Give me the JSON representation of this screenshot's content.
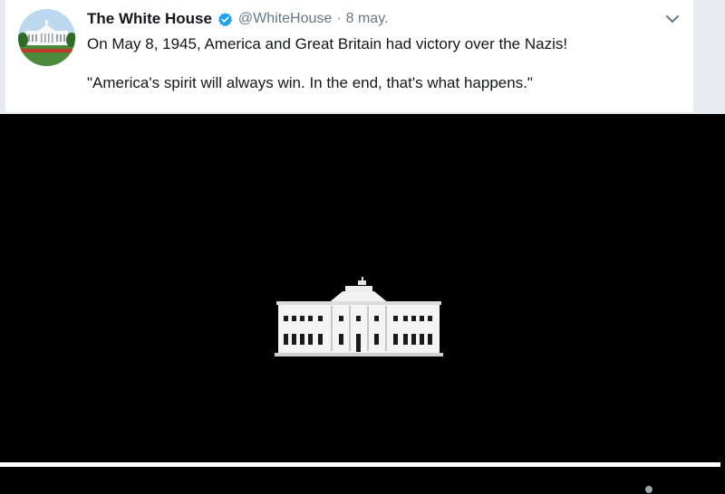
{
  "tweet": {
    "display_name": "The White House",
    "handle": "@WhiteHouse",
    "separator": "·",
    "date": "8 may.",
    "text_line1": "On May 8, 1945, America and Great Britain had victory over the Nazis!",
    "text_line2": "\"America's spirit will always win. In the end, that's what happens.\"",
    "verified_color": "#1da1f2",
    "avatar_icon": "white-house-photo",
    "menu_icon": "chevron-down-icon"
  },
  "video": {
    "background_color": "#000000",
    "logo_icon": "white-house-logo",
    "progress_fraction": 1.0
  }
}
